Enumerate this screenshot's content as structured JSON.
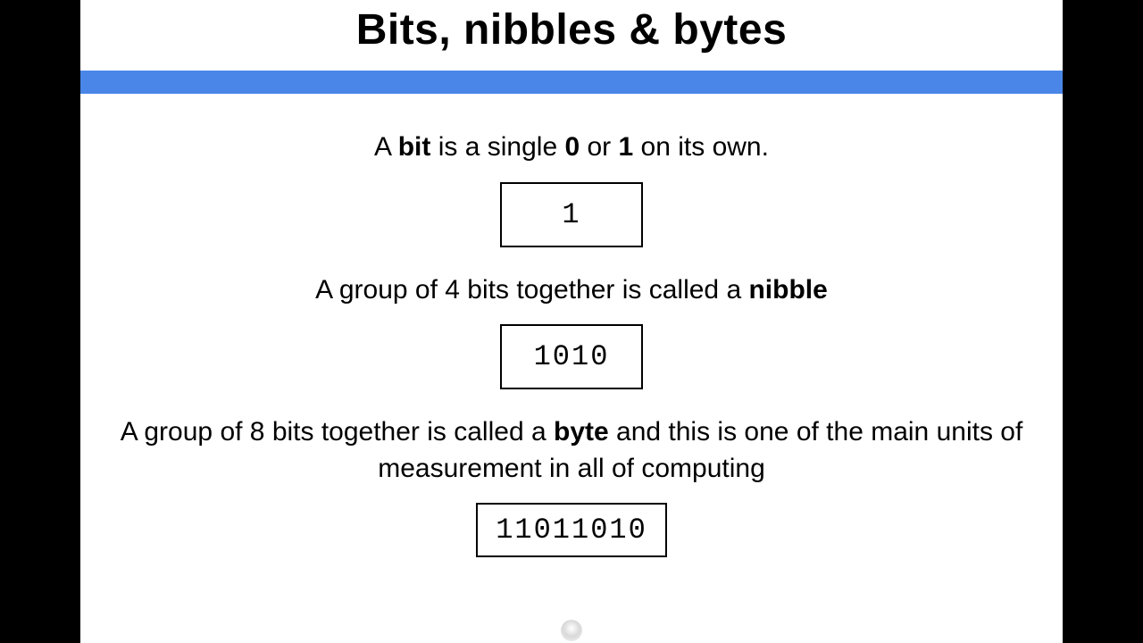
{
  "title": "Bits, nibbles & bytes",
  "bit": {
    "text_parts": [
      "A ",
      "bit",
      " is a single ",
      "0",
      " or ",
      "1",
      " on its own."
    ],
    "example": "1"
  },
  "nibble": {
    "text_parts": [
      "A group of 4 bits together is called a ",
      "nibble"
    ],
    "example": "1010"
  },
  "byte": {
    "text_parts": [
      "A group of 8 bits together is called a ",
      "byte",
      " and this is one of the main units of measurement in all of computing"
    ],
    "example": "11011010"
  }
}
